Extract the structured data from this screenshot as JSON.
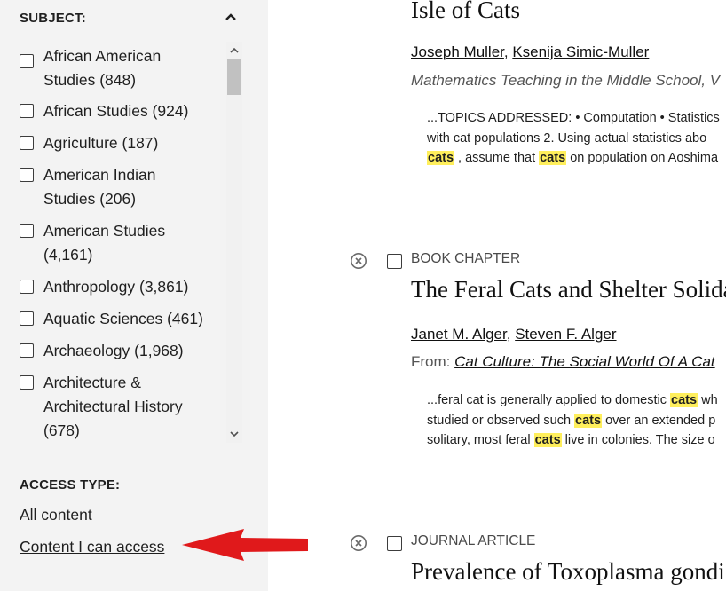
{
  "subject_filter": {
    "heading": "SUBJECT:",
    "items": [
      {
        "line1": "African American",
        "line2": "Studies (848)"
      },
      {
        "line1": "African Studies (924)",
        "line2": ""
      },
      {
        "line1": "Agriculture (187)",
        "line2": ""
      },
      {
        "line1": "American Indian",
        "line2": "Studies (206)"
      },
      {
        "line1": "American Studies",
        "line2": "(4,161)"
      },
      {
        "line1": "Anthropology (3,861)",
        "line2": ""
      },
      {
        "line1": "Aquatic Sciences (461)",
        "line2": ""
      },
      {
        "line1": "Archaeology (1,968)",
        "line2": ""
      },
      {
        "line1": "Architecture &",
        "line2": "Architectural History",
        "line3": "(678)"
      }
    ]
  },
  "access_filter": {
    "heading": "ACCESS TYPE:",
    "all_content": "All content",
    "content_i_can_access": "Content I can access"
  },
  "results": [
    {
      "title": "Isle of Cats",
      "authors": [
        "Joseph Muller",
        "Ksenija Simic-Muller"
      ],
      "source": "Mathematics Teaching in the Middle School, V",
      "snippet": [
        {
          "pre": "...TOPICS ADDRESSED: • Computation • Statistics",
          "hl": "",
          "post": ""
        },
        {
          "pre": "with cat populations 2. Using actual statistics abo",
          "hl": "",
          "post": ""
        },
        {
          "pre": "",
          "hl": "cats",
          "post": " , assume that ",
          "hl2": "cats",
          "post2": " on population on Aoshima"
        }
      ]
    },
    {
      "type": "BOOK CHAPTER",
      "title": "The Feral Cats and Shelter Solida",
      "authors": [
        "Janet M. Alger",
        "Steven F. Alger"
      ],
      "from_label": "From: ",
      "source": "Cat Culture: The Social World Of A Cat",
      "snippet": [
        {
          "pre": "...feral cat is generally applied to domestic ",
          "hl": "cats",
          "post": " wh"
        },
        {
          "pre": "studied or observed such ",
          "hl": "cats",
          "post": " over an extended p"
        },
        {
          "pre": "solitary, most feral ",
          "hl": "cats",
          "post": " live in colonies. The size o"
        }
      ]
    },
    {
      "type": "JOURNAL ARTICLE",
      "title": "Prevalence of Toxoplasma gondi"
    }
  ],
  "colors": {
    "highlight": "#ffef5c",
    "arrow": "#e0191b",
    "sidebar_bg": "#f3f3f3"
  }
}
